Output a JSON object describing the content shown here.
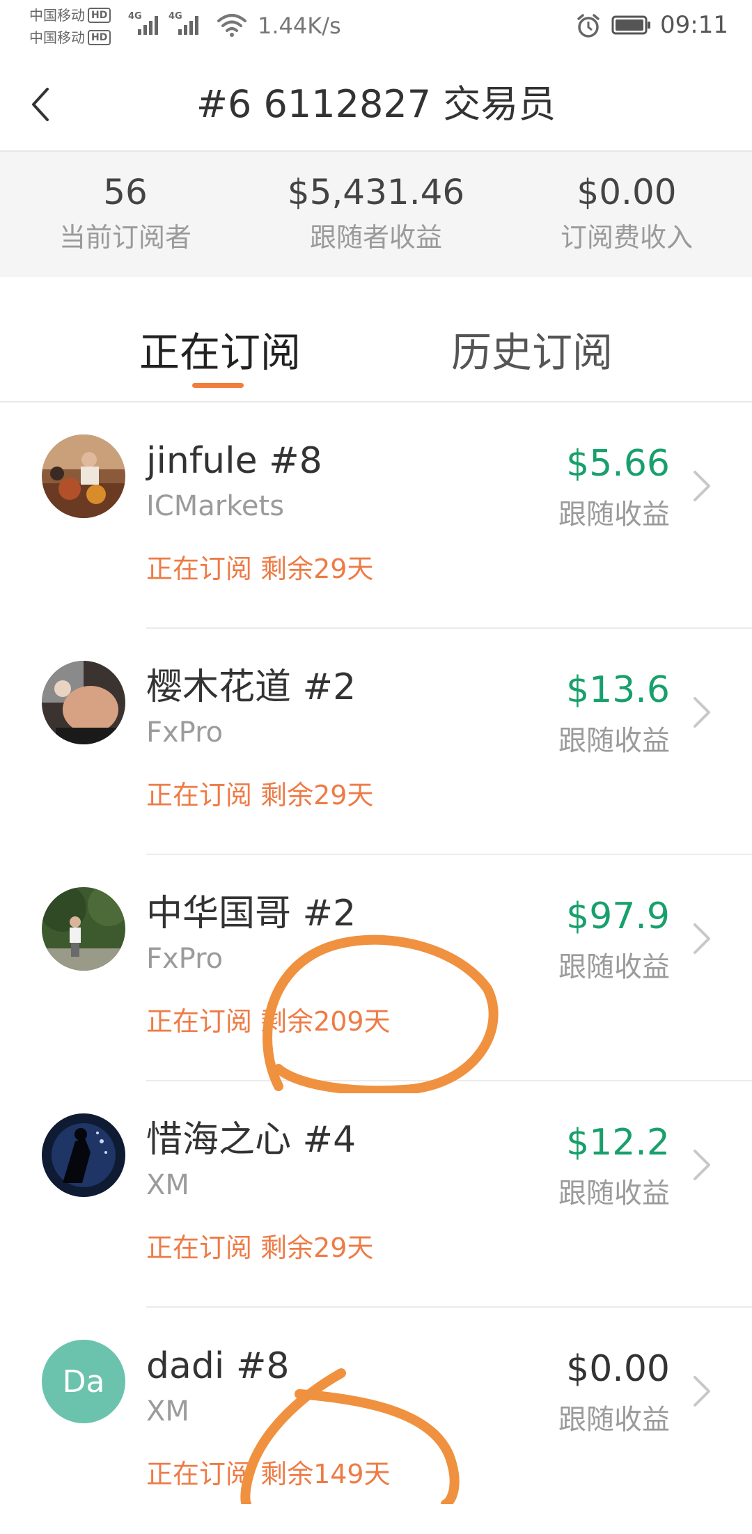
{
  "status_bar": {
    "carrier1": "中国移动",
    "carrier2": "中国移动",
    "hd": "HD",
    "net_tag": "4G",
    "net_speed": "1.44K/s",
    "time": "09:11"
  },
  "header": {
    "title": "#6 6112827 交易员"
  },
  "stats": [
    {
      "value": "56",
      "label": "当前订阅者"
    },
    {
      "value": "$5,431.46",
      "label": "跟随者收益"
    },
    {
      "value": "$0.00",
      "label": "订阅费收入"
    }
  ],
  "tabs": {
    "active": "正在订阅",
    "inactive": "历史订阅"
  },
  "amount_label": "跟随收益",
  "subscribers": [
    {
      "name": "jinfule #8",
      "broker": "ICMarkets",
      "status": "正在订阅 剩余29天",
      "amount": "$5.66"
    },
    {
      "name": "樱木花道 #2",
      "broker": "FxPro",
      "status": "正在订阅 剩余29天",
      "amount": "$13.6"
    },
    {
      "name": "中华国哥 #2",
      "broker": "FxPro",
      "status": "正在订阅 剩余209天",
      "amount": "$97.9"
    },
    {
      "name": "惜海之心 #4",
      "broker": "XM",
      "status": "正在订阅 剩余29天",
      "amount": "$12.2"
    },
    {
      "name": "dadi #8",
      "broker": "XM",
      "status": "正在订阅 剩余149天",
      "amount": "$0.00",
      "avatar_initials": "Da"
    }
  ],
  "colors": {
    "accent": "#f27c3c",
    "positive": "#18a06c",
    "status_text": "#ee7b46",
    "annotation": "#f0913f",
    "avatar_da_bg": "#6cc3ad"
  }
}
